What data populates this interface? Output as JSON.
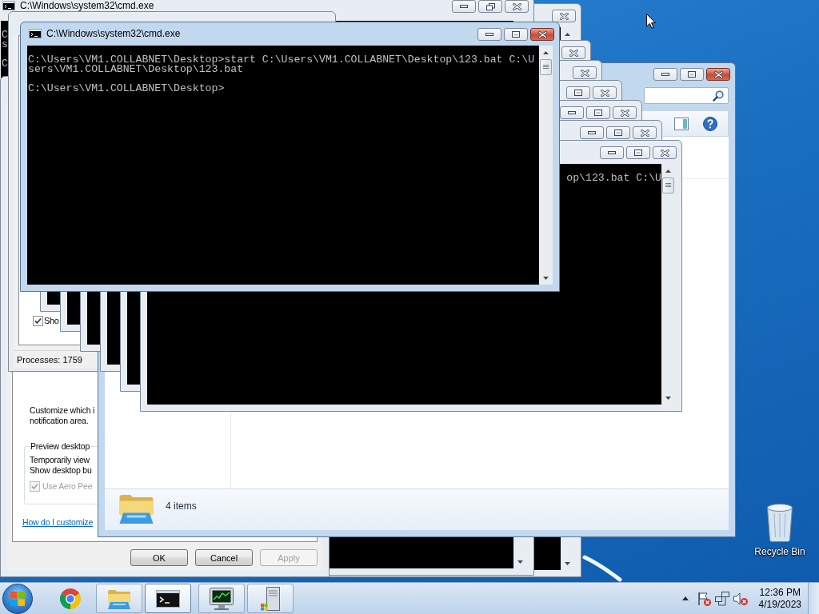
{
  "windows": [
    {
      "kind": "console",
      "active": true,
      "maximized": false,
      "title": "C:\\Windows\\system32\\cmd.exe",
      "output": [
        [
          "C:\\Users\\VM1.COLLABNET\\Desktop>start C:\\Users\\VM1.COLLABNET\\Desktop\\123.bat C:\\U",
          "sers\\VM1.COLLABNET\\Desktop\\123.bat"
        ],
        [
          "C:\\Users\\VM1.COLLABNET\\Desktop>"
        ]
      ]
    },
    {
      "kind": "console",
      "active": false,
      "maximized": false,
      "output": [
        [
          "op\\123.bat C:\\U"
        ]
      ]
    },
    {
      "kind": "console",
      "active": false,
      "maximized": false
    },
    {
      "kind": "console",
      "active": false,
      "maximized": false
    },
    {
      "kind": "console",
      "active": false,
      "maximized": false
    },
    {
      "kind": "console",
      "active": false
    },
    {
      "kind": "console",
      "active": false
    },
    {
      "kind": "explorer",
      "active": true,
      "maximized": false,
      "status": "4 items"
    },
    {
      "kind": "task_manager",
      "checkbox": {
        "label": "Sho",
        "checked": true
      },
      "status": "Processes: 1759"
    },
    {
      "kind": "dialog",
      "description": [
        "Customize which i",
        "notification area."
      ],
      "group": {
        "title": "Preview desktop",
        "lines": [
          "Temporarily view",
          "Show desktop bu"
        ],
        "checkbox": {
          "label": "Use Aero Pee",
          "checked": true,
          "disabled": true
        }
      },
      "link": "How do I customize",
      "buttons": [
        {
          "label": "OK",
          "disabled": false
        },
        {
          "label": "Cancel",
          "disabled": false
        },
        {
          "label": "Apply",
          "disabled": true
        }
      ]
    },
    {
      "kind": "console",
      "active": false,
      "maximized": true,
      "title": "C:\\Windows\\system32\\cmd.exe",
      "output": [
        [
          "C",
          "s"
        ],
        [
          "C"
        ]
      ]
    },
    {
      "kind": "console",
      "active": false
    }
  ],
  "desktop": {
    "icons": [
      {
        "label": "Recycle Bin"
      }
    ]
  },
  "taskbar": {
    "apps": [
      {
        "kind": "browser",
        "running": false,
        "selected": false
      },
      {
        "kind": "folder",
        "running": true,
        "selected": false
      },
      {
        "kind": "terminal",
        "running": true,
        "selected": true
      },
      {
        "kind": "monitor",
        "running": true,
        "selected": false
      },
      {
        "kind": "server",
        "running": true,
        "selected": false
      }
    ],
    "clock": {
      "time": "12:36 PM",
      "date": "4/19/2023"
    }
  }
}
